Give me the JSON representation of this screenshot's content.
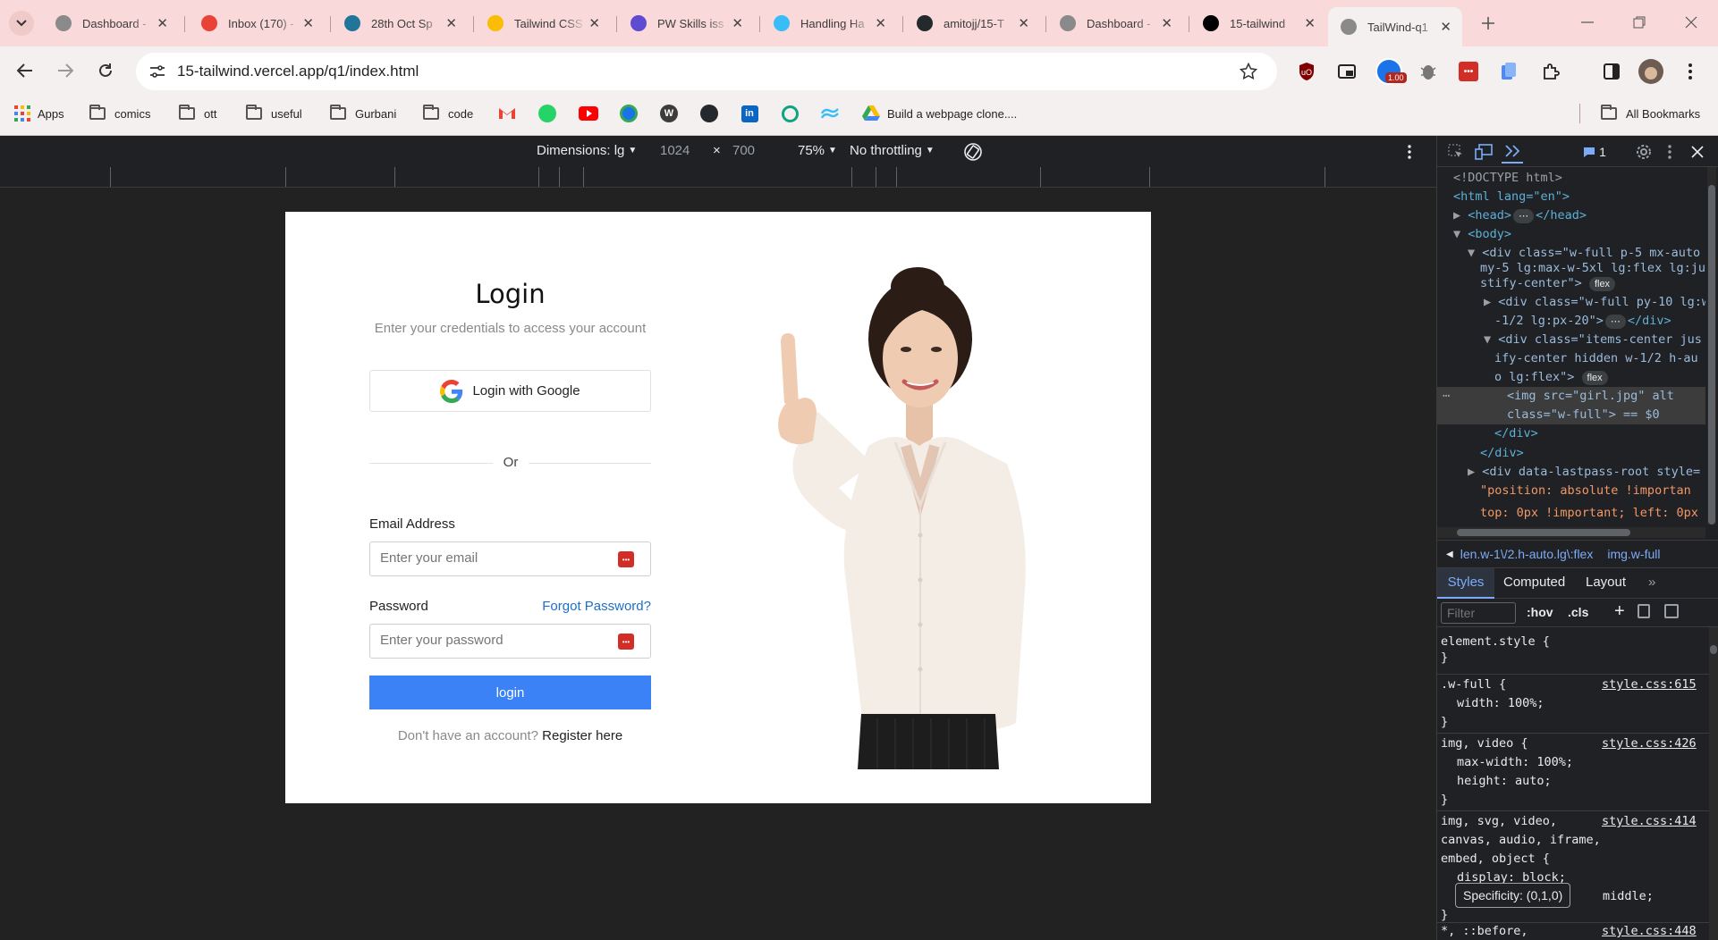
{
  "browser": {
    "tabs": [
      {
        "title": "Dashboard - ",
        "favicon_color": "#8a8a8a"
      },
      {
        "title": "Inbox (170) - ",
        "favicon_color": "#ea4335"
      },
      {
        "title": "28th Oct Sp",
        "favicon_color": "#21759b"
      },
      {
        "title": "Tailwind CSS",
        "favicon_color": "#fbbc04"
      },
      {
        "title": "PW Skills iss",
        "favicon_color": "#5f4bd2"
      },
      {
        "title": "Handling Ha",
        "favicon_color": "#38bdf8"
      },
      {
        "title": "amitojj/15-T",
        "favicon_color": "#24292e"
      },
      {
        "title": "Dashboard - ",
        "favicon_color": "#8a8a8a"
      },
      {
        "title": "15-tailwind",
        "favicon_color": "#000000"
      },
      {
        "title": "TailWind-q1",
        "favicon_color": "#8a8a8a",
        "active": true
      }
    ],
    "url": "15-tailwind.vercel.app/q1/index.html",
    "extension_badge": "1.00",
    "bookmarks": [
      {
        "label": "Apps",
        "kind": "apps"
      },
      {
        "label": "comics",
        "kind": "folder"
      },
      {
        "label": "ott",
        "kind": "folder"
      },
      {
        "label": "useful",
        "kind": "folder"
      },
      {
        "label": "Gurbani",
        "kind": "folder"
      },
      {
        "label": "code",
        "kind": "folder"
      },
      {
        "label": "Build a webpage clone....",
        "kind": "drive"
      }
    ],
    "all_bookmarks": "All Bookmarks"
  },
  "device_toolbar": {
    "dimensions": "Dimensions: lg",
    "width": "1024",
    "times": "×",
    "height": "700",
    "zoom": "75%",
    "throttling": "No throttling"
  },
  "page": {
    "title": "Login",
    "subtitle": "Enter your credentials to access your account",
    "google_button": "Login with Google",
    "divider": "Or",
    "email_label": "Email Address",
    "email_placeholder": "Enter your email",
    "password_label": "Password",
    "forgot": "Forgot Password?",
    "password_placeholder": "Enter your password",
    "login_button": "login",
    "no_account": "Don't have an account?",
    "register": "Register here"
  },
  "devtools": {
    "issues_count": "1",
    "dom": [
      {
        "text": "<!DOCTYPE html>"
      },
      {
        "text": "<html lang=\"en\">"
      },
      {
        "text": "<head>"
      },
      {
        "text": "</head>"
      },
      {
        "text": "<body>"
      },
      {
        "text": "<div class=\"w-full p-5 mx-auto"
      },
      {
        "text": "my-5 lg:max-w-5xl lg:flex lg:ju"
      },
      {
        "text": "stify-center\">"
      },
      {
        "text": "<div class=\"w-full py-10 lg:w"
      },
      {
        "text": "-1/2 lg:px-20\">"
      },
      {
        "text": "</div>"
      },
      {
        "text": "<div class=\"items-center jus"
      },
      {
        "text": "ify-center hidden w-1/2 h-au"
      },
      {
        "text": "o lg:flex\">"
      },
      {
        "text": "<img src=\"girl.jpg\" alt"
      },
      {
        "text": "class=\"w-full\"> == $0"
      },
      {
        "text": "</div>"
      },
      {
        "text": "</div>"
      },
      {
        "text": "<div data-lastpass-root style="
      },
      {
        "text": "\"position: absolute !importan"
      },
      {
        "text": "top: 0px !important; left: 0px"
      }
    ],
    "flex_badge": "flex",
    "breadcrumb": [
      "len.w-1\\/2.h-auto.lg\\:flex",
      "img.w-full"
    ],
    "panel_tabs": [
      "Styles",
      "Computed",
      "Layout"
    ],
    "filter_placeholder": "Filter",
    "hov": ":hov",
    "cls": ".cls",
    "rules": [
      {
        "selector": "element.style {",
        "source": "",
        "props": []
      },
      {
        "selector": ".w-full {",
        "source": "style.css:615",
        "props": [
          "width: 100%;"
        ]
      },
      {
        "selector": "img, video {",
        "source": "style.css:426",
        "props": [
          "max-width: 100%;",
          "height: auto;"
        ]
      },
      {
        "selector": "img, svg, video, canvas, audio, iframe, embed, object {",
        "source": "style.css:414",
        "props": [
          "display: block;",
          "middle;"
        ]
      },
      {
        "selector": "*, ::before,",
        "source": "style.css:448",
        "props": []
      }
    ],
    "tooltip": "Specificity: (0,1,0)"
  }
}
